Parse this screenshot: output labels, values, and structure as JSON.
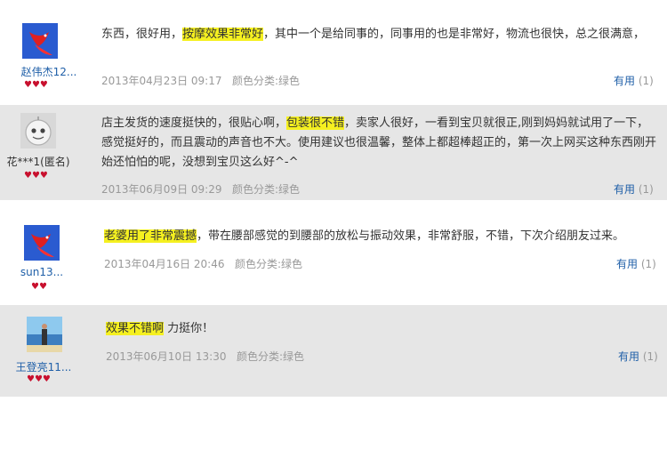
{
  "reviews": [
    {
      "username": "赵伟杰12...",
      "avatar": "goldfish-avatar",
      "hearts": "♥♥♥",
      "text_before": "东西，很好用，",
      "highlight": "按摩效果非常好",
      "text_after": "，其中一个是给同事的，同事用的也是非常好，物流也很快，总之很满意，",
      "date": "2013年04月23日 09:17",
      "color_category": "颜色分类:绿色",
      "helpful_label": "有用",
      "helpful_count": "(1)",
      "background": "#ffffff"
    },
    {
      "username": "花***1(匿名)",
      "avatar": "anonymous-face-avatar",
      "hearts": "♥♥♥",
      "text_before": "店主发货的速度挺快的，很贴心啊，",
      "highlight": "包装很不错",
      "text_after": "，卖家人很好，一看到宝贝就很正,刚到妈妈就试用了一下，感觉挺好的，而且震动的声音也不大。使用建议也很温馨，整体上都超棒超正的，第一次上网买这种东西刚开始还怕怕的呢，没想到宝贝这么好^-^",
      "date": "2013年06月09日 09:29",
      "color_category": "颜色分类:绿色",
      "helpful_label": "有用",
      "helpful_count": "(1)",
      "background": "#e6e6e6"
    },
    {
      "username": "sun13...",
      "avatar": "goldfish-avatar",
      "hearts": "♥♥",
      "text_before": "",
      "highlight": "老婆用了非常震撼",
      "text_after": "，带在腰部感觉的到腰部的放松与振动效果，非常舒服，不错，下次介绍朋友过来。",
      "date": "2013年04月16日 20:46",
      "color_category": "颜色分类:绿色",
      "helpful_label": "有用",
      "helpful_count": "(1)",
      "background": "#ffffff"
    },
    {
      "username": "王登亮11...",
      "avatar": "beach-photo-avatar",
      "hearts": "♥♥♥",
      "text_before": "",
      "highlight": "效果不错啊",
      "text_after": " 力挺你！",
      "date": "2013年06月10日 13:30",
      "color_category": "颜色分类:绿色",
      "helpful_label": "有用",
      "helpful_count": "(1)",
      "background": "#e6e6e6"
    }
  ],
  "colors": {
    "highlight": "#f5f020",
    "username_link": "#1f5fa8",
    "hearts": "#c8102e"
  }
}
